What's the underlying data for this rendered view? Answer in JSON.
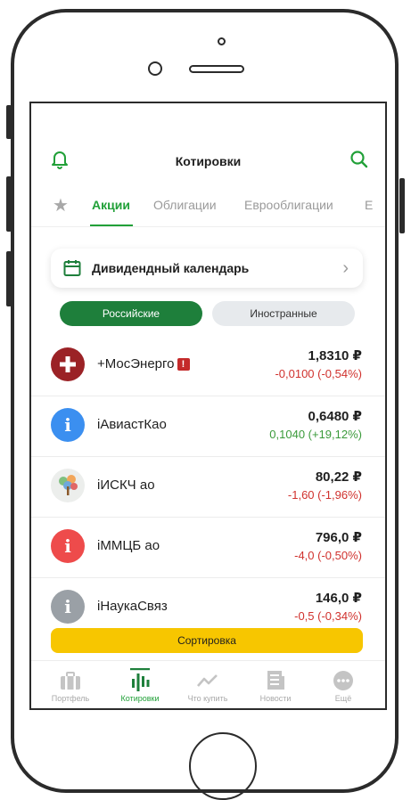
{
  "header": {
    "title": "Котировки",
    "bell_icon": "bell-icon",
    "search_icon": "search-icon"
  },
  "tabs": [
    {
      "label": "Акции",
      "active": true
    },
    {
      "label": "Облигации",
      "active": false
    },
    {
      "label": "Еврооблигации",
      "active": false
    },
    {
      "label": "E",
      "active": false
    }
  ],
  "calendar": {
    "label": "Дивидендный календарь"
  },
  "segments": {
    "russian": "Российские",
    "foreign": "Иностранные"
  },
  "stocks": [
    {
      "name": "+МосЭнерго",
      "warning": "!",
      "price": "1,8310 ₽",
      "change": "-0,0100 (-0,54%)",
      "direction": "down",
      "logo_color": "#9b2226",
      "logo_glyph": "+"
    },
    {
      "name": "iАвиастКао",
      "price": "0,6480 ₽",
      "change": "0,1040 (+19,12%)",
      "direction": "up",
      "logo_color": "#3b8ff0",
      "logo_glyph": "i"
    },
    {
      "name": "iИСКЧ ао",
      "price": "80,22 ₽",
      "change": "-1,60 (-1,96%)",
      "direction": "down",
      "logo_color": "#e9ece9",
      "logo_glyph": ""
    },
    {
      "name": "iММЦБ ао",
      "price": "796,0 ₽",
      "change": "-4,0 (-0,50%)",
      "direction": "down",
      "logo_color": "#ee4b4b",
      "logo_glyph": "i"
    },
    {
      "name": "iНаукаСвяз",
      "price": "146,0 ₽",
      "change": "-0,5 (-0,34%)",
      "direction": "down",
      "logo_color": "#9aa0a6",
      "logo_glyph": "i"
    }
  ],
  "sort_button": {
    "label": "Сортировка"
  },
  "tabbar": [
    {
      "label": "Портфель",
      "icon": "briefcase-icon",
      "active": false
    },
    {
      "label": "Котировки",
      "icon": "quotes-icon",
      "active": true
    },
    {
      "label": "Что купить",
      "icon": "trend-icon",
      "active": false
    },
    {
      "label": "Новости",
      "icon": "news-icon",
      "active": false
    },
    {
      "label": "Ещё",
      "icon": "more-icon",
      "active": false
    }
  ]
}
